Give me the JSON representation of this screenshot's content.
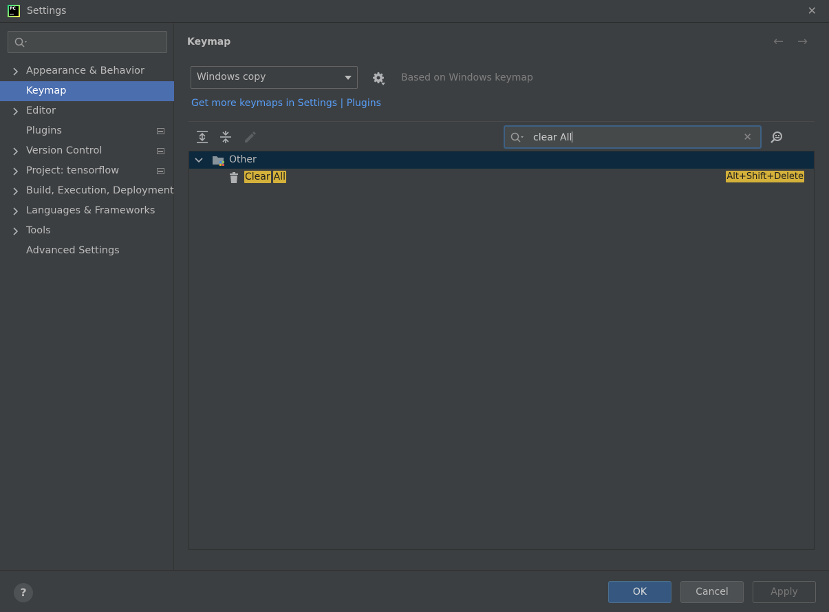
{
  "window": {
    "title": "Settings",
    "logo_text": "PC"
  },
  "sidebar": {
    "search_placeholder": "",
    "items": [
      {
        "label": "Appearance & Behavior",
        "expandable": true,
        "selected": false
      },
      {
        "label": "Keymap",
        "expandable": false,
        "selected": true
      },
      {
        "label": "Editor",
        "expandable": true,
        "selected": false
      },
      {
        "label": "Plugins",
        "expandable": false,
        "selected": false,
        "project_icon": true
      },
      {
        "label": "Version Control",
        "expandable": true,
        "selected": false,
        "project_icon": true
      },
      {
        "label": "Project: tensorflow",
        "expandable": true,
        "selected": false,
        "project_icon": true
      },
      {
        "label": "Build, Execution, Deployment",
        "expandable": true,
        "selected": false
      },
      {
        "label": "Languages & Frameworks",
        "expandable": true,
        "selected": false
      },
      {
        "label": "Tools",
        "expandable": true,
        "selected": false
      },
      {
        "label": "Advanced Settings",
        "expandable": false,
        "selected": false
      }
    ]
  },
  "main": {
    "title": "Keymap",
    "keymap_selected": "Windows copy",
    "based_on": "Based on Windows keymap",
    "more_link": "Get more keymaps in Settings | Plugins",
    "search": {
      "value": "clear All"
    },
    "tree": {
      "group": {
        "label": "Other"
      },
      "action": {
        "name_part1": "Clear",
        "name_part2": "All",
        "shortcut": "Alt+Shift+Delete"
      }
    }
  },
  "footer": {
    "help": "?",
    "ok": "OK",
    "cancel": "Cancel",
    "apply": "Apply"
  },
  "colors": {
    "background": "#3c3f41",
    "selection": "#4b6eaf",
    "link": "#589df6",
    "highlight": "#d4b13a",
    "tree_selection": "#0d293e"
  }
}
